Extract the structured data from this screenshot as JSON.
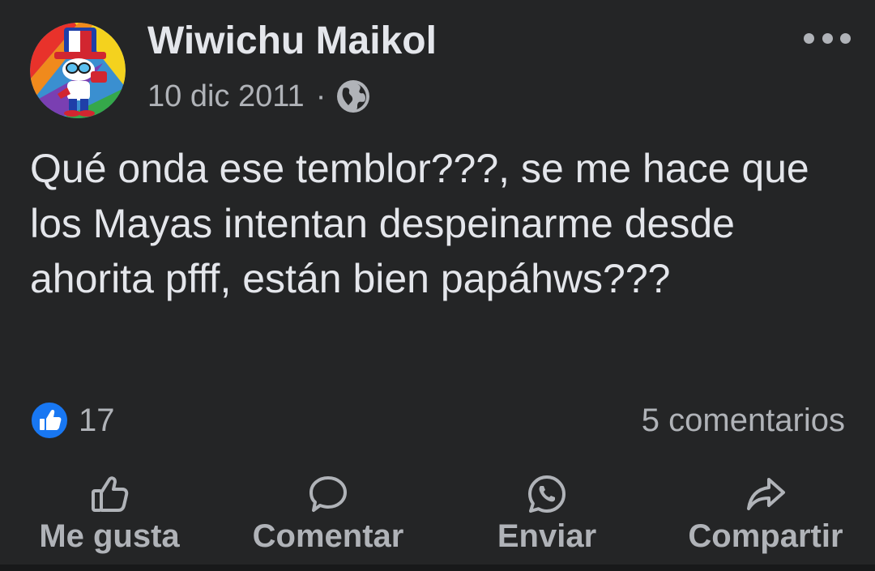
{
  "post": {
    "author": "Wiwichu Maikol",
    "date": "10 dic 2011",
    "separator": "·",
    "audience_icon": "globe-icon",
    "text": "Qué onda ese temblor???, se me hace que los Mayas intentan despeinarme desde ahorita pfff, están bien papáhws???",
    "likes": "17",
    "comments": "5 comentarios"
  },
  "actions": {
    "like": "Me gusta",
    "comment": "Comentar",
    "send": "Enviar",
    "share": "Compartir"
  },
  "colors": {
    "background": "#242526",
    "primary_text": "#e4e6eb",
    "secondary_text": "#b0b3b8",
    "like_blue": "#1877f2"
  }
}
